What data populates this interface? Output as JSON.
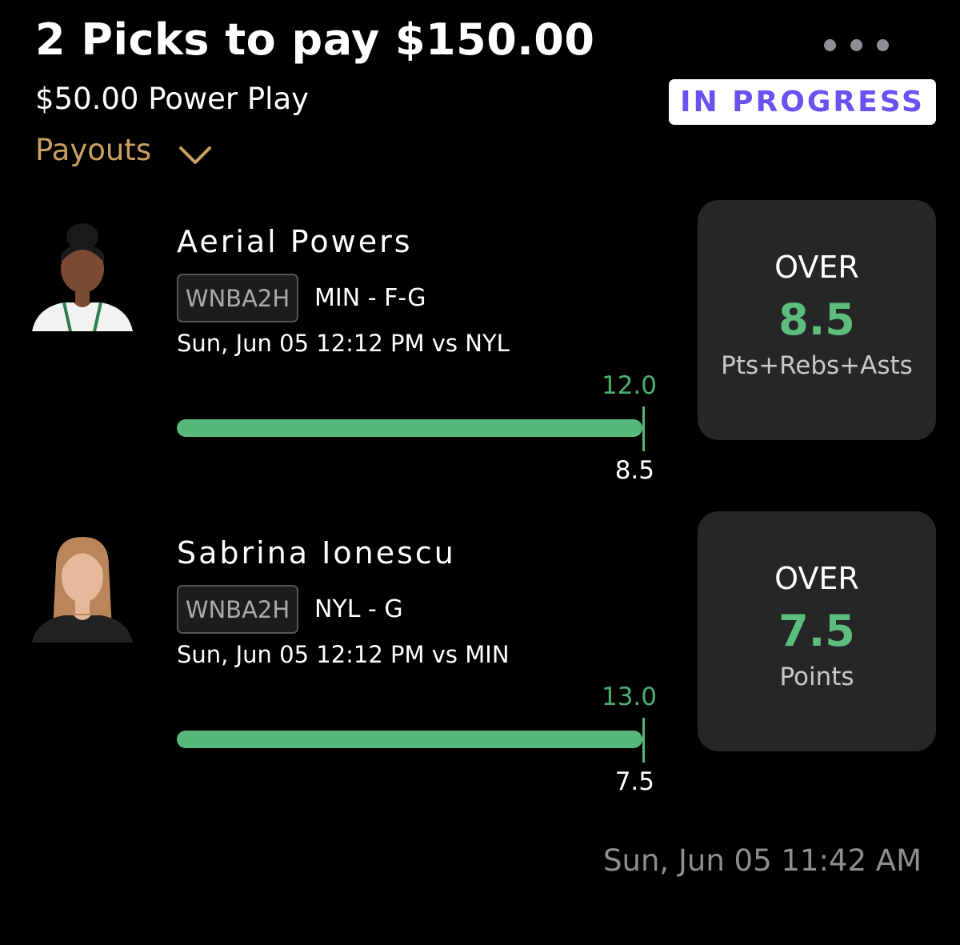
{
  "header": {
    "title": "2 Picks to pay $150.00",
    "subtitle": "$50.00 Power Play",
    "payouts_label": "Payouts",
    "status": "IN PROGRESS"
  },
  "picks": [
    {
      "player": "Aerial Powers",
      "league": "WNBA2H",
      "team_position": "MIN - F-G",
      "game": "Sun, Jun 05 12:12 PM  vs NYL",
      "actual": "12.0",
      "line": "8.5",
      "progress": 1.0,
      "direction": "OVER",
      "line_value": "8.5",
      "stat": "Pts+Rebs+Asts",
      "jersey_color": "#2e7d4f"
    },
    {
      "player": "Sabrina Ionescu",
      "league": "WNBA2H",
      "team_position": "NYL - G",
      "game": "Sun, Jun 05 12:12 PM  vs MIN",
      "actual": "13.0",
      "line": "7.5",
      "progress": 1.0,
      "direction": "OVER",
      "line_value": "7.5",
      "stat": "Points",
      "jersey_color": "#c49a6c"
    }
  ],
  "footer": {
    "timestamp": "Sun, Jun 05 11:42 AM"
  },
  "colors": {
    "accent_gold": "#c9a062",
    "status_purple": "#6a52f0",
    "progress_green": "#56b87a"
  }
}
